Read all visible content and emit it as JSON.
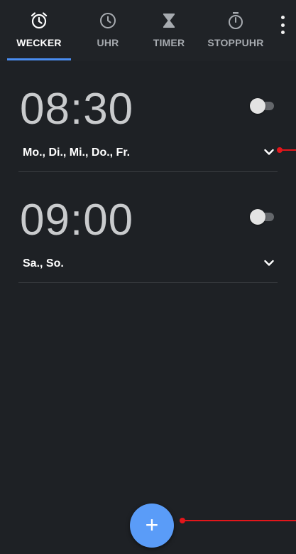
{
  "tabs": [
    {
      "label": "WECKER",
      "icon": "alarm-clock-icon",
      "active": true
    },
    {
      "label": "UHR",
      "icon": "clock-icon",
      "active": false
    },
    {
      "label": "TIMER",
      "icon": "hourglass-icon",
      "active": false
    },
    {
      "label": "STOPPUHR",
      "icon": "stopwatch-icon",
      "active": false
    }
  ],
  "menu_icon": "more-vert-icon",
  "alarms": [
    {
      "time": "08:30",
      "days": "Mo., Di., Mi., Do., Fr.",
      "enabled": false
    },
    {
      "time": "09:00",
      "days": "Sa., So.",
      "enabled": false
    }
  ],
  "fab": {
    "label": "+",
    "icon": "add-icon"
  },
  "colors": {
    "background": "#1e2125",
    "accent": "#4a8df0",
    "fab": "#5a9cf8",
    "annotation": "#e3161b"
  }
}
